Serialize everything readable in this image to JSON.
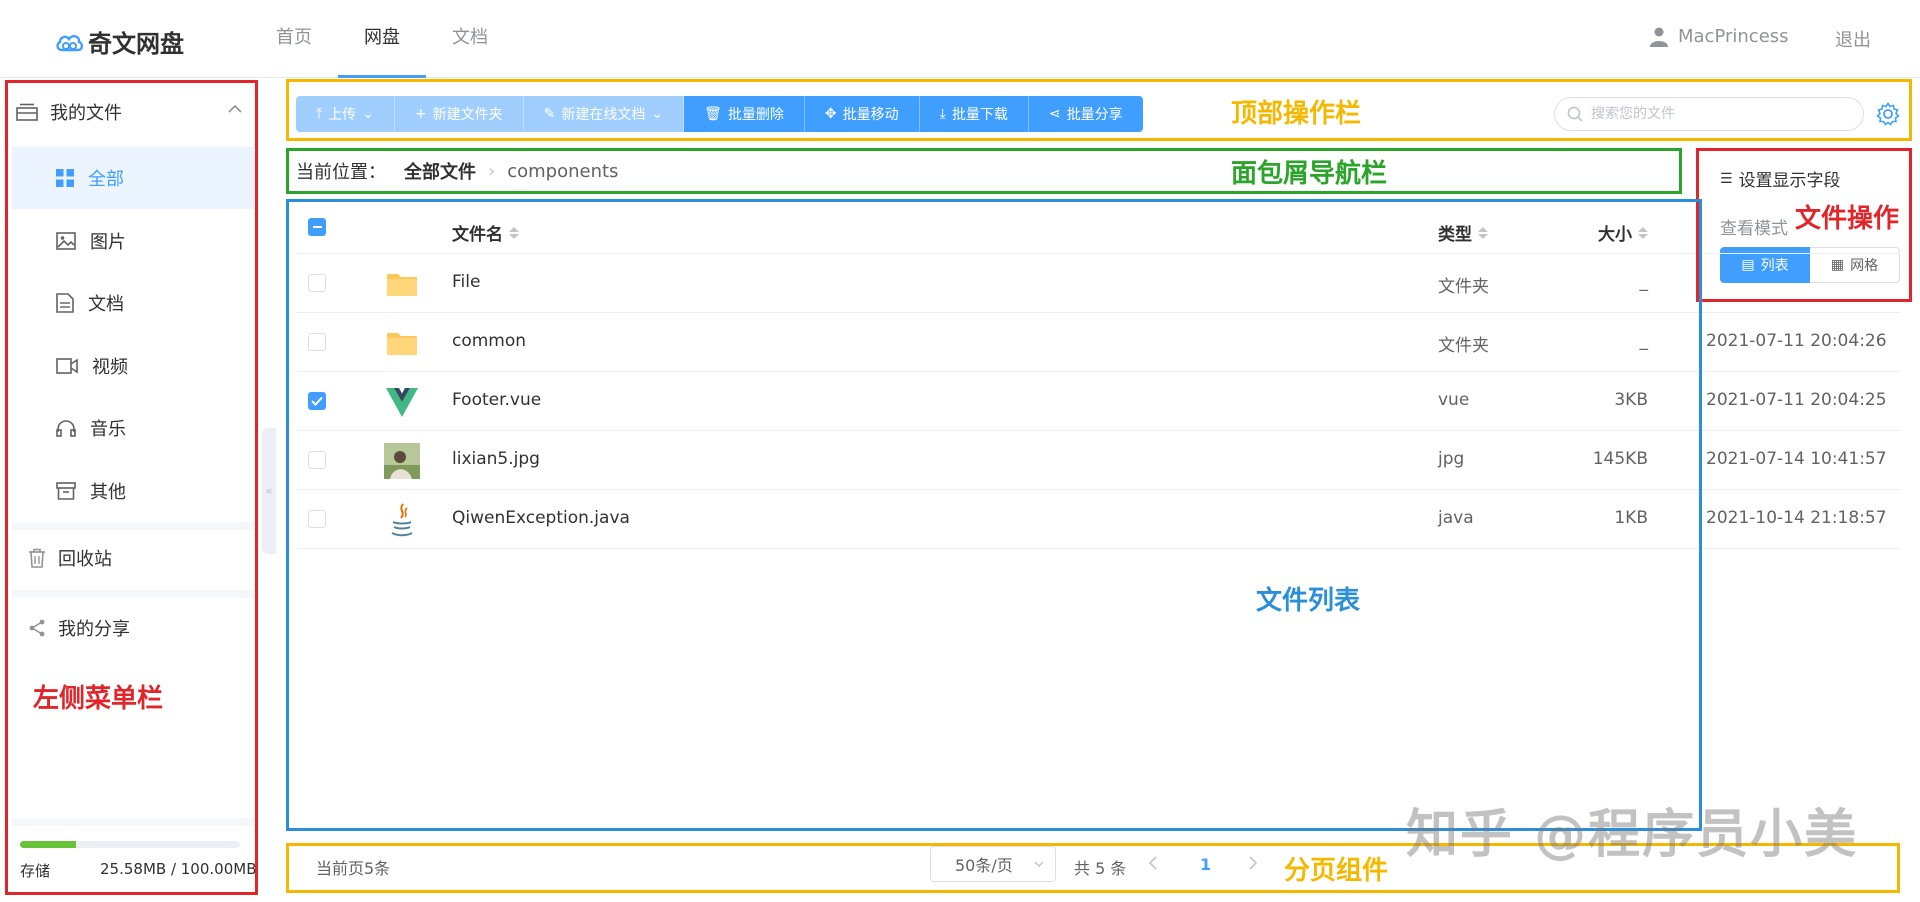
{
  "header": {
    "logo_text": "奇文网盘",
    "nav": [
      "首页",
      "网盘",
      "文档"
    ],
    "username": "MacPrincess",
    "logout": "退出"
  },
  "sidebar": {
    "my_files": "我的文件",
    "items": [
      {
        "label": "全部",
        "icon": "grid-icon"
      },
      {
        "label": "图片",
        "icon": "image-icon"
      },
      {
        "label": "文档",
        "icon": "document-icon"
      },
      {
        "label": "视频",
        "icon": "video-icon"
      },
      {
        "label": "音乐",
        "icon": "headphones-icon"
      },
      {
        "label": "其他",
        "icon": "archive-icon"
      }
    ],
    "recycle": "回收站",
    "shares": "我的分享",
    "storage_label": "存储",
    "storage_value": "25.58MB / 100.00MB",
    "storage_fraction": 0.2558
  },
  "toolbar": {
    "upload": "上传",
    "new_folder": "新建文件夹",
    "new_online_doc": "新建在线文档",
    "batch_delete": "批量删除",
    "batch_move": "批量移动",
    "batch_download": "批量下载",
    "batch_share": "批量分享",
    "search_placeholder": "搜索您的文件"
  },
  "breadcrumb": {
    "label": "当前位置：",
    "root": "全部文件",
    "current": "components"
  },
  "table": {
    "headers": {
      "name": "文件名",
      "type": "类型",
      "size": "大小"
    },
    "rows": [
      {
        "name": "File",
        "type": "文件夹",
        "size": "_",
        "date": "",
        "checked": false,
        "icon": "folder-icon"
      },
      {
        "name": "common",
        "type": "文件夹",
        "size": "_",
        "date": "2021-07-11 20:04:26",
        "checked": false,
        "icon": "folder-icon"
      },
      {
        "name": "Footer.vue",
        "type": "vue",
        "size": "3KB",
        "date": "2021-07-11 20:04:25",
        "checked": true,
        "icon": "vue-icon"
      },
      {
        "name": "lixian5.jpg",
        "type": "jpg",
        "size": "145KB",
        "date": "2021-07-14 10:41:57",
        "checked": false,
        "icon": "image-thumbnail"
      },
      {
        "name": "QiwenException.java",
        "type": "java",
        "size": "1KB",
        "date": "2021-10-14 21:18:57",
        "checked": false,
        "icon": "java-icon"
      }
    ]
  },
  "view_panel": {
    "set_fields": "设置显示字段",
    "view_mode": "查看模式",
    "list": "列表",
    "grid": "网格"
  },
  "pagination": {
    "current_count": "当前页5条",
    "page_size": "50条/页",
    "total": "共 5 条",
    "page": "1"
  },
  "annotations": {
    "top_bar": "顶部操作栏",
    "breadcrumb": "面包屑导航栏",
    "file_ops": "文件操作",
    "file_list": "文件列表",
    "left_menu": "左侧菜单栏",
    "pagination": "分页组件"
  },
  "watermark": "知乎 @程序员小美",
  "colors": {
    "primary": "#409eff",
    "primary_light": "#a0cfff",
    "anno_yellow": "#f5b800",
    "anno_green": "#2aa52a",
    "anno_red": "#e0262b",
    "anno_blue": "#2a8fd8"
  }
}
